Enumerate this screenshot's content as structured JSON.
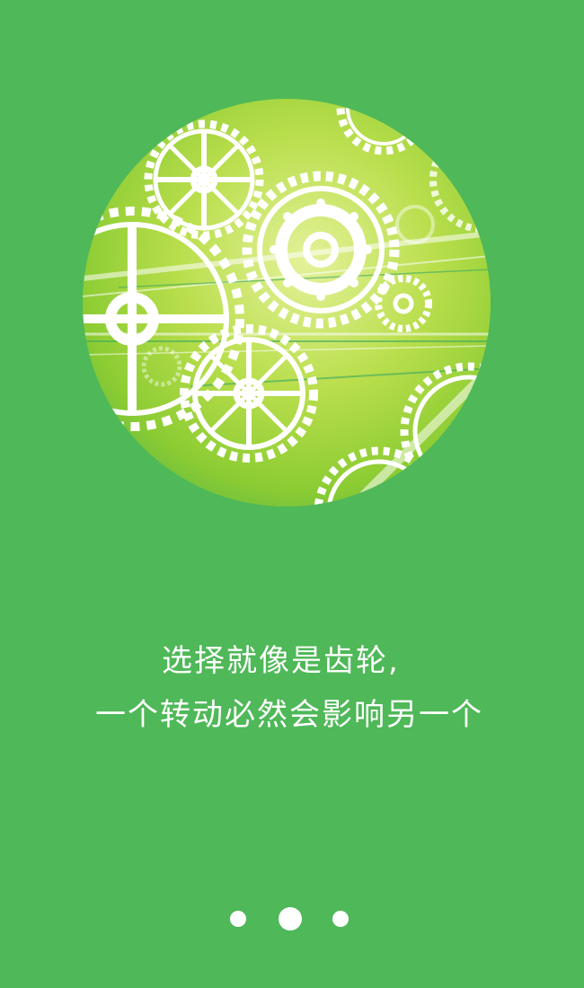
{
  "onboarding": {
    "caption_line1": "选择就像是齿轮,",
    "caption_line2": "一个转动必然会影响另一个"
  },
  "pager": {
    "page_count": 3,
    "active_index": 1
  },
  "colors": {
    "background": "#4fb858",
    "text": "#ffffff",
    "illustration_light": "#d6ec7a",
    "illustration_mid": "#a6d43a",
    "illustration_dark": "#5cb844"
  },
  "illustration": {
    "icon": "gears-illustration"
  }
}
